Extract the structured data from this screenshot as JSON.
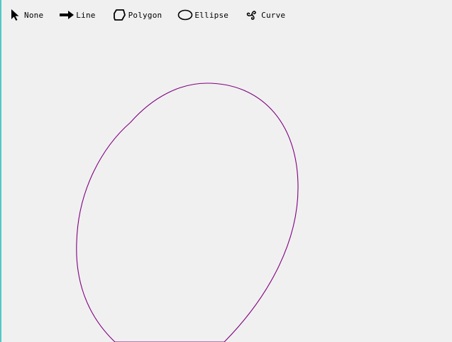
{
  "toolbar": {
    "tools": [
      {
        "label": "None",
        "icon": "cursor-arrow-icon"
      },
      {
        "label": "Line",
        "icon": "arrow-right-icon"
      },
      {
        "label": "Polygon",
        "icon": "polygon-icon"
      },
      {
        "label": "Ellipse",
        "icon": "ellipse-icon"
      },
      {
        "label": "Curve",
        "icon": "triskelion-icon"
      }
    ]
  },
  "canvas": {
    "shape": "ellipse",
    "stroke_color": "#800080",
    "background_color": "#f0f0f0"
  }
}
